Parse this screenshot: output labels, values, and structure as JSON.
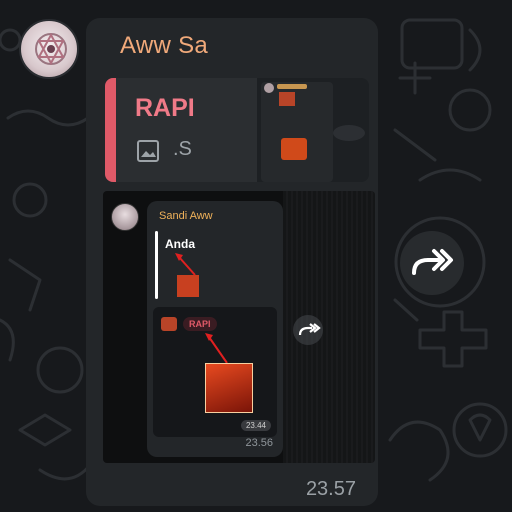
{
  "message": {
    "sender": "Aww Sa",
    "time": "23.57",
    "reply": {
      "name": "RAPI",
      "subtitle": ".S",
      "icon": "photo-icon"
    },
    "forwarded_screenshot": {
      "sender": "Sandi Aww",
      "reply_name": "Anda",
      "chip_label": "RAPI",
      "media_time": "23.44",
      "time": "23.56"
    }
  },
  "actions": {
    "forward_icon": "forward-arrow-icon"
  },
  "colors": {
    "background": "#17191c",
    "bubble": "#232629",
    "sender": "#f0a97a",
    "reply_accent": "#e05a68",
    "inner_sender": "#f0b25a"
  }
}
